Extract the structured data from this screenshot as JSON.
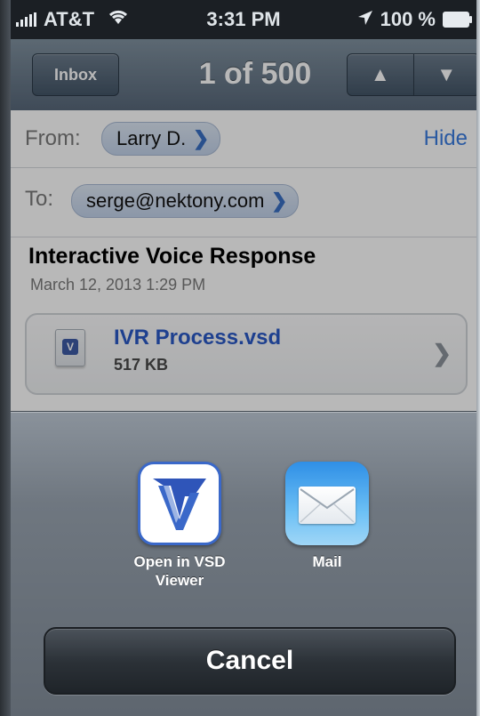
{
  "status_bar": {
    "carrier": "AT&T",
    "time": "3:31 PM",
    "battery": "100 %"
  },
  "nav": {
    "back_label": "Inbox",
    "title": "1 of 500",
    "up_icon": "up-triangle-icon",
    "down_icon": "down-triangle-icon"
  },
  "email": {
    "from_label": "From:",
    "from_name": "Larry D.",
    "hide_label": "Hide",
    "to_label": "To:",
    "to_email": "serge@nektony.com",
    "subject": "Interactive Voice Response",
    "date": "March 12, 2013 1:29 PM",
    "attachment": {
      "name": "IVR Process.vsd",
      "size": "517 KB"
    }
  },
  "action_sheet": {
    "apps": [
      {
        "label_line1": "Open in VSD",
        "label_line2": "Viewer",
        "icon": "vsd-viewer-icon"
      },
      {
        "label_line1": "Mail",
        "icon": "mail-icon"
      }
    ],
    "cancel_label": "Cancel"
  },
  "colors": {
    "link": "#3a7ce0",
    "attachment_name": "#2a59c6",
    "nav_bar": "#6b7b8b",
    "sheet": "#6f7780"
  }
}
